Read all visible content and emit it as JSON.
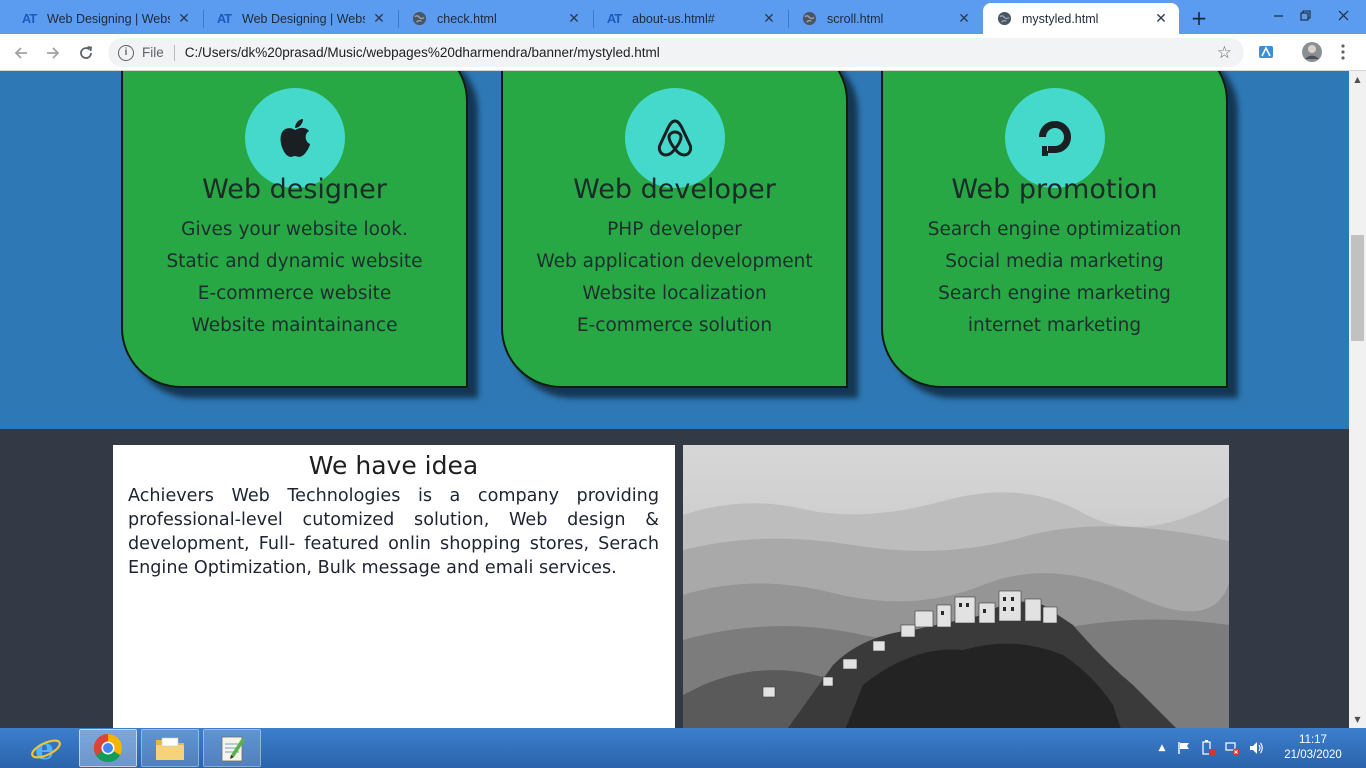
{
  "browser": {
    "tabs": [
      {
        "title": "Web Designing | Website",
        "favicon": "at-logo-icon",
        "active": false
      },
      {
        "title": "Web Designing | Website",
        "favicon": "at-logo-icon",
        "active": false
      },
      {
        "title": "check.html",
        "favicon": "globe-icon",
        "active": false
      },
      {
        "title": "about-us.html#",
        "favicon": "at-logo-icon",
        "active": false
      },
      {
        "title": "scroll.html",
        "favicon": "globe-icon",
        "active": false
      },
      {
        "title": "mystyled.html",
        "favicon": "globe-icon",
        "active": true
      }
    ],
    "favicon_text": "AT",
    "close_glyph": "✕",
    "new_tab_glyph": "+",
    "address": {
      "scheme_label": "File",
      "url": "C:/Users/dk%20prasad/Music/webpages%20dharmendra/banner/mystyled.html"
    }
  },
  "services": {
    "cards": [
      {
        "icon": "apple-icon",
        "title": "Web designer",
        "items": [
          "Gives your website look.",
          "Static and dynamic website",
          "E-commerce website",
          "Website maintainance"
        ]
      },
      {
        "icon": "airbnb-icon",
        "title": "Web developer",
        "items": [
          "PHP developer",
          "Web application development",
          "Website localization",
          "E-commerce solution"
        ]
      },
      {
        "icon": "digitalocean-icon",
        "title": "Web promotion",
        "items": [
          "Search engine optimization",
          "Social media marketing",
          "Search engine marketing",
          "internet marketing"
        ]
      }
    ]
  },
  "about": {
    "title": "We have idea",
    "text": "Achievers Web Technologies is a company providing professional-level cutomized solution, Web design & development, Full- featured onlin shopping stores, Serach Engine Optimization, Bulk message and emali services."
  },
  "taskbar": {
    "apps": [
      "internet-explorer-icon",
      "chrome-icon",
      "file-explorer-icon",
      "notepad-icon"
    ],
    "time": "11:17",
    "date": "21/03/2020"
  },
  "colors": {
    "services_bg": "#2e78b5",
    "card_green": "#27a844",
    "badge_teal": "#45d9cc",
    "about_bg": "#333a45"
  }
}
